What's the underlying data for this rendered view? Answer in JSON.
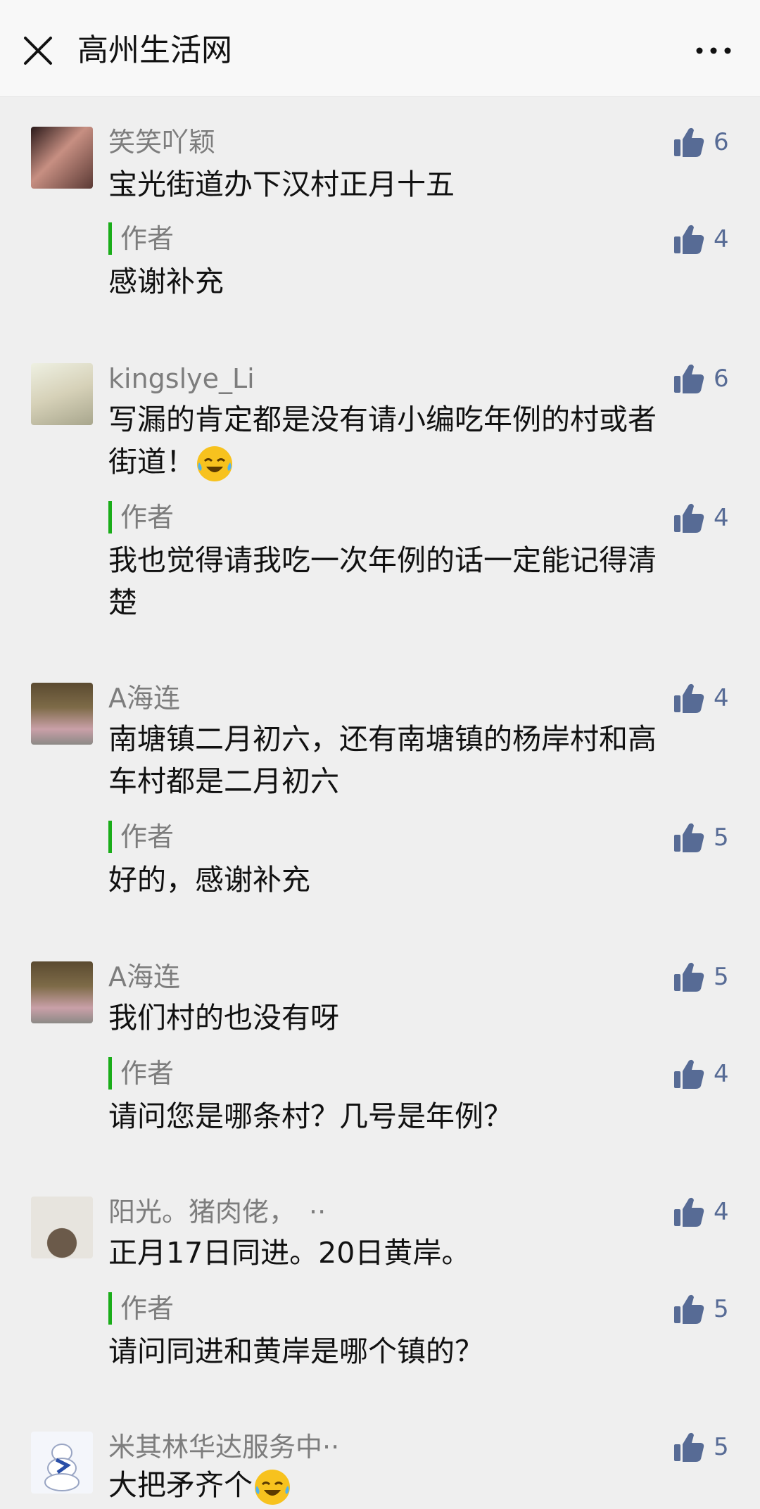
{
  "header": {
    "title": "高州生活网",
    "close_icon": "close-icon",
    "more_icon": "more-icon"
  },
  "colors": {
    "author_bar": "#1aad19",
    "like_count": "#576b95",
    "nick": "#7d7d7d"
  },
  "comments": [
    {
      "nick": "笑笑吖颖",
      "text": "宝光街道办下汉村正月十五",
      "likes": "6",
      "reply": {
        "label": "作者",
        "text": "感谢补充",
        "likes": "4"
      }
    },
    {
      "nick": "kingslye_Li",
      "text": "写漏的肯定都是没有请小编吃年例的村或者",
      "text2": "街道！",
      "likes": "6",
      "reply": {
        "label": "作者",
        "text": "我也觉得请我吃一次年例的话一定能记得清",
        "text2": "楚",
        "likes": "4"
      }
    },
    {
      "nick": "A海连",
      "text": "南塘镇二月初六，还有南塘镇的杨岸村和高",
      "text2": "车村都是二月初六",
      "likes": "4",
      "reply": {
        "label": "作者",
        "text": "好的，感谢补充",
        "likes": "5"
      }
    },
    {
      "nick": "A海连",
      "text": "我们村的也没有呀",
      "likes": "5",
      "reply": {
        "label": "作者",
        "text": "请问您是哪条村？几号是年例？",
        "likes": "4"
      }
    },
    {
      "nick": "阳光。猪肉佬，　··",
      "text": "正月17日同进。20日黄岸。",
      "likes": "4",
      "reply": {
        "label": "作者",
        "text": "请问同进和黄岸是哪个镇的？",
        "likes": "5"
      }
    },
    {
      "nick": "米其林华达服务中··",
      "text": "大把矛齐个",
      "likes": "5"
    }
  ]
}
